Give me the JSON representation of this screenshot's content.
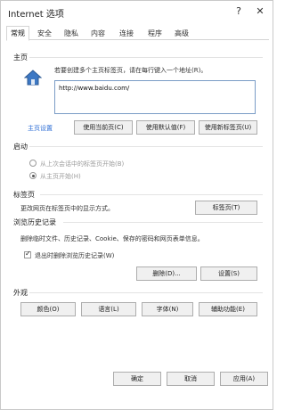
{
  "window": {
    "title": "Internet 选项",
    "help_glyph": "?",
    "close_glyph": "✕"
  },
  "tabs": [
    {
      "label": "常规"
    },
    {
      "label": "安全"
    },
    {
      "label": "隐私"
    },
    {
      "label": "内容"
    },
    {
      "label": "连接"
    },
    {
      "label": "程序"
    },
    {
      "label": "高级"
    }
  ],
  "homepage": {
    "section_title": "主页",
    "description": "若要创建多个主页标签页，请在每行键入一个地址(R)。",
    "url": "http://www.baidu.com/",
    "current_link": "主页设置",
    "use_current": "使用当前页(C)",
    "use_default": "使用默认值(F)",
    "use_new_tab": "使用新标签页(U)"
  },
  "startup": {
    "section_title": "启动",
    "option_last_session": "从上次会话中的标签页开始(B)",
    "option_homepage": "从主页开始(H)",
    "selected": "homepage"
  },
  "tabs_section": {
    "section_title": "标签页",
    "description": "更改网页在标签页中的显示方式。",
    "button": "标签页(T)"
  },
  "history": {
    "section_title": "浏览历史记录",
    "description": "删除临时文件、历史记录、Cookie、保存的密码和网页表单信息。",
    "checkbox_label": "退出时删除浏览历史记录(W)",
    "checkbox_checked": true,
    "delete_button": "删除(D)...",
    "settings_button": "设置(S)"
  },
  "appearance": {
    "section_title": "外观",
    "colors": "颜色(O)",
    "languages": "语言(L)",
    "fonts": "字体(N)",
    "accessibility": "辅助功能(E)"
  },
  "footer": {
    "ok": "确定",
    "cancel": "取消",
    "apply": "应用(A)"
  },
  "colors": {
    "link": "#2a6bd4",
    "focus_border": "#7a9cc6"
  },
  "icons": {
    "homepage_icon": "house-icon",
    "help_icon": "help-icon",
    "close_icon": "close-icon"
  }
}
